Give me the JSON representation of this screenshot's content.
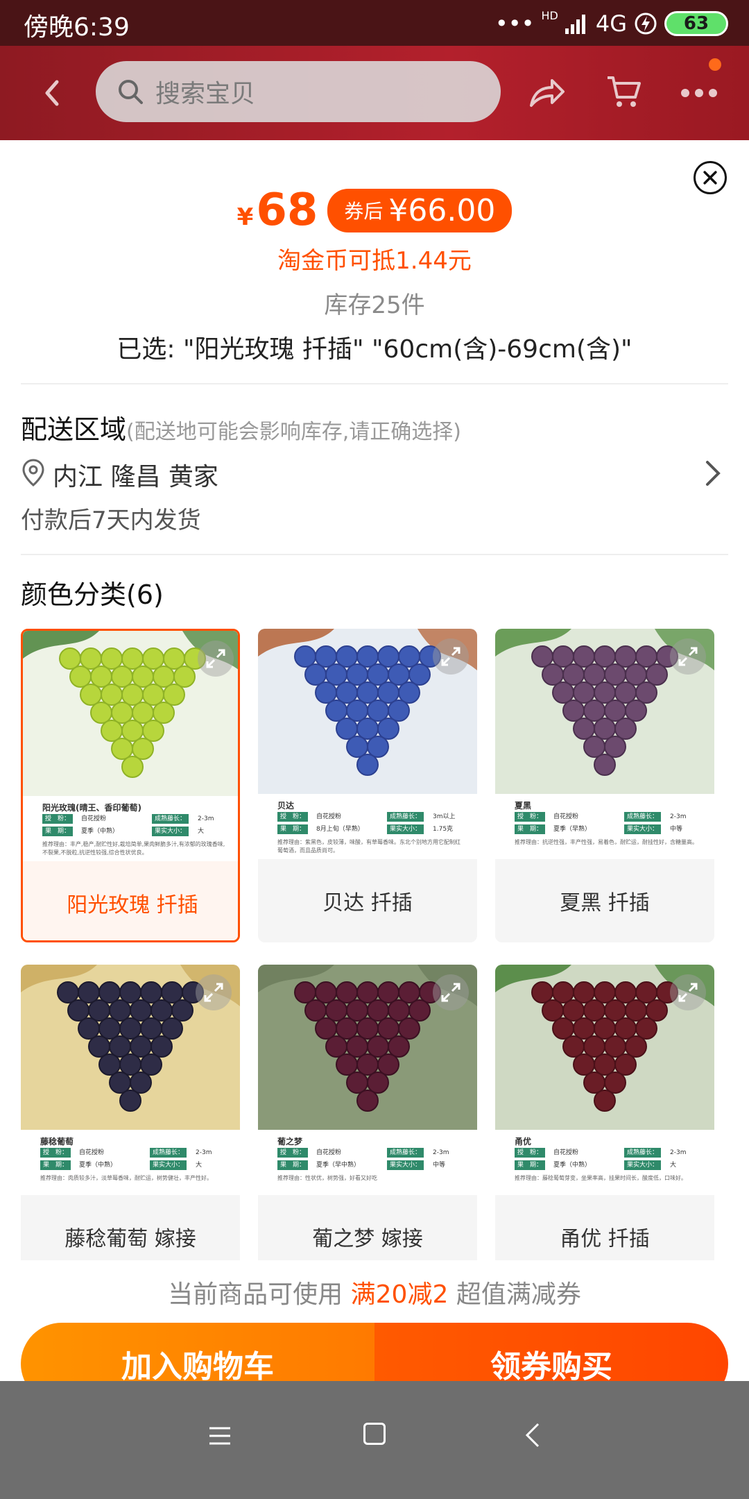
{
  "status_bar": {
    "time": "傍晚6:39",
    "hd": "HD",
    "network": "4G",
    "battery": "63"
  },
  "top_nav": {
    "search_placeholder": "搜索宝贝"
  },
  "product": {
    "currency": "¥",
    "price": "68",
    "coupon_label": "券后",
    "coupon_price": "¥66.00",
    "taojin_text": "淘金币可抵1.44元",
    "stock_text": "库存25件",
    "selected_text": "已选: \"阳光玫瑰 扦插\" \"60cm(含)-69cm(含)\""
  },
  "delivery": {
    "title": "配送区域",
    "hint": "(配送地可能会影响库存,请正确选择)",
    "location": "内江 隆昌 黄家",
    "ship_time": "付款后7天内发货"
  },
  "color_section": {
    "title": "颜色分类(6)",
    "items": [
      {
        "label": "阳光玫瑰 扦插",
        "img_title": "阳光玫瑰(晴王、香印葡萄)",
        "pollination": "自花授粉",
        "length": "2-3m",
        "season": "夏季（中熟）",
        "size": "大",
        "note": "推荐理由：丰产,稳产,耐贮性好,栽培简单,果肉鲜脆多汁,有浓郁的玫瑰香味,不裂果,不脱粒,抗逆性较强,综合性状优良。"
      },
      {
        "label": "贝达 扦插",
        "img_title": "贝达",
        "pollination": "自花授粉",
        "length": "3m以上",
        "season": "8月上旬（早熟）",
        "size": "1.75克",
        "note": "推荐理由：紫黑色，皮较薄，味酸，有草莓香味。东北个别地方用它配制红葡萄酒，而且品质尚可。"
      },
      {
        "label": "夏黑 扦插",
        "img_title": "夏黑",
        "pollination": "自花授粉",
        "length": "2-3m",
        "season": "夏季（早熟）",
        "size": "中等",
        "note": "推荐理由：抗逆性强，丰产性强，易着色，耐贮运，耐挂性好，含糖量高。"
      },
      {
        "label": "藤稔葡萄 嫁接",
        "img_title": "藤稔葡萄",
        "pollination": "自花授粉",
        "length": "2-3m",
        "season": "夏季（中熟）",
        "size": "大",
        "note": "推荐理由：肉质较多汁，淡草莓香味，耐贮运，树势健壮，丰产性好。"
      },
      {
        "label": "葡之梦 嫁接",
        "img_title": "葡之梦",
        "pollination": "自花授粉",
        "length": "2-3m",
        "season": "夏季（早中熟）",
        "size": "中等",
        "note": "推荐理由：性状优，树势强，好看又好吃"
      },
      {
        "label": "甬优 扦插",
        "img_title": "甬优",
        "pollination": "自花授粉",
        "length": "2-3m",
        "season": "夏季（中熟）",
        "size": "大",
        "note": "推荐理由：藤稔葡萄芽变，坐果率高，挂果时间长，酸度低，口味好。"
      }
    ],
    "tag_labels": {
      "pollination": "授　粉：",
      "length": "成熟藤长：",
      "season": "果　期：",
      "size": "果实大小："
    }
  },
  "promo": {
    "prefix": "当前商品可使用",
    "highlight": "满20减2",
    "suffix": "超值满减券"
  },
  "actions": {
    "add_to_cart": "加入购物车",
    "buy_with_coupon": "领券购买"
  },
  "colors": {
    "accent": "#ff5000",
    "cart_button": "#ff8a00",
    "nav_red": "#a81e28",
    "status_bar": "#4a1416"
  }
}
